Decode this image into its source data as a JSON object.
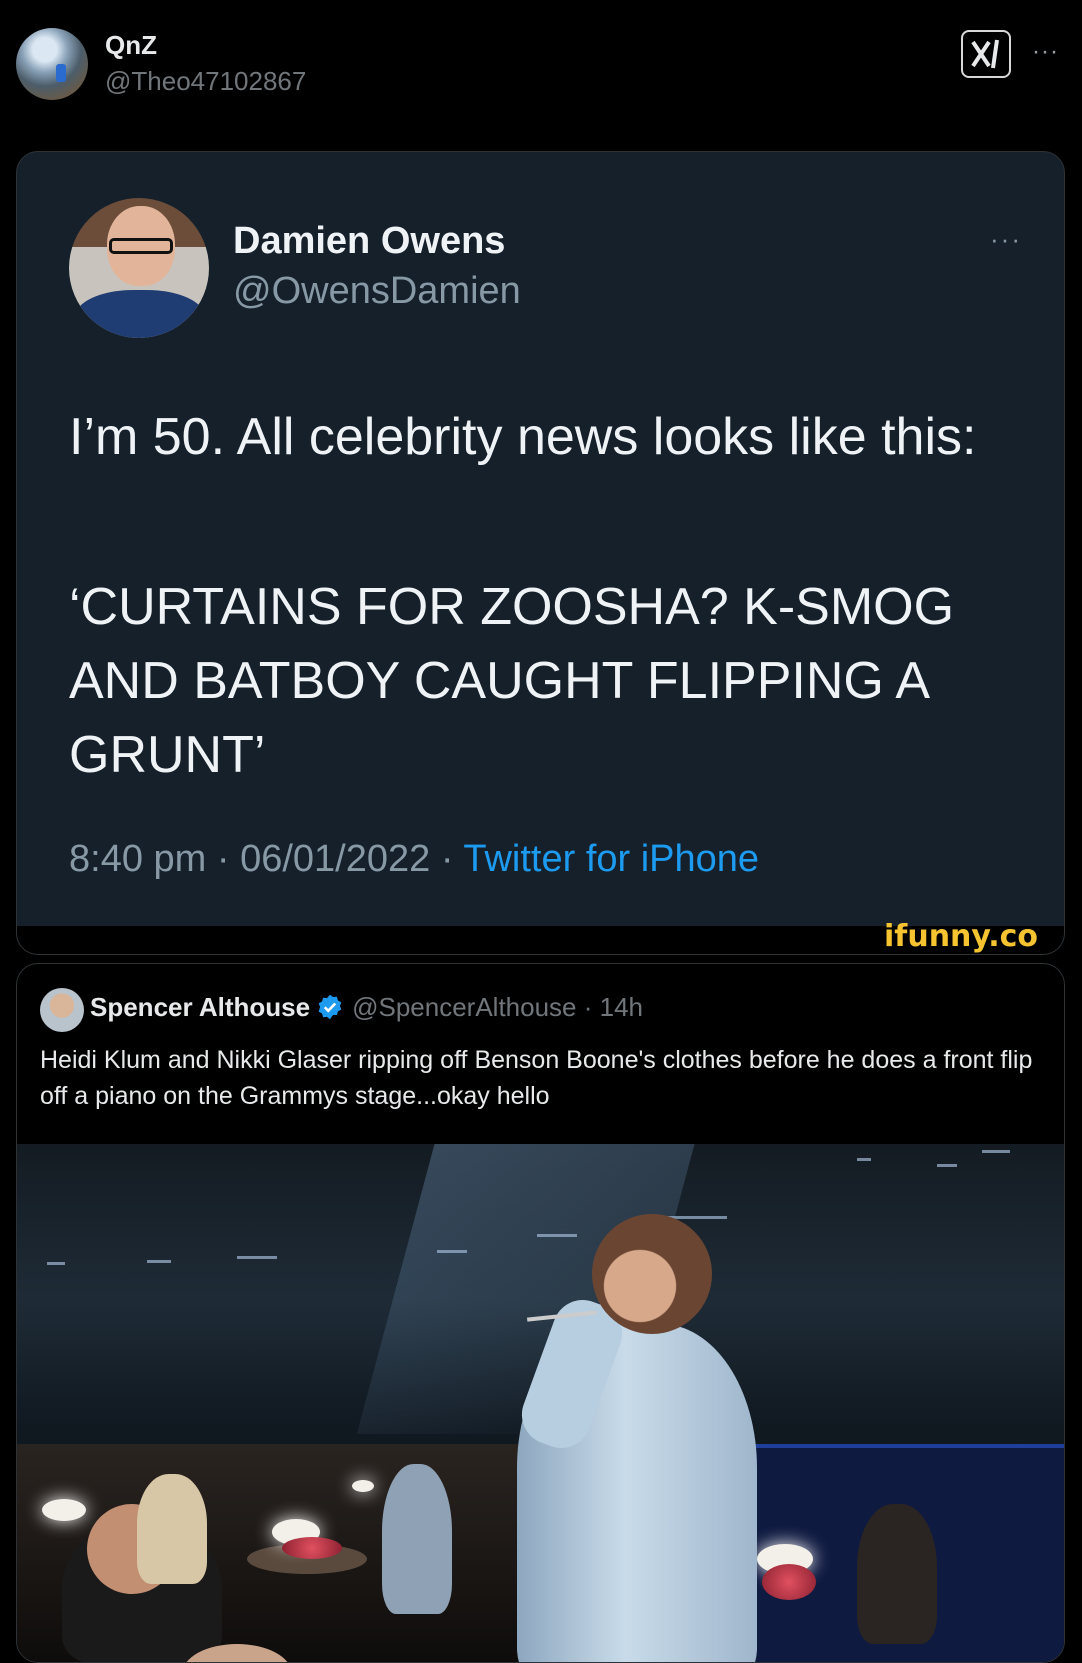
{
  "header": {
    "display_name": "QnZ",
    "handle": "@Theo47102867",
    "more_label": "···"
  },
  "screenshot_tweet": {
    "name": "Damien Owens",
    "handle": "@OwensDamien",
    "more_label": "···",
    "text_line": "I’m 50. All celebrity news looks like this:",
    "quote": "‘CURTAINS FOR ZOOSHA? K-SMOG AND BATBOY CAUGHT FLIPPING A GRUNT’",
    "time": "8:40 pm",
    "date": "06/01/2022",
    "source": "Twitter for iPhone",
    "watermark": "ifunny.co"
  },
  "quoted_tweet": {
    "name": "Spencer Althouse",
    "handle": "@SpencerAlthouse",
    "age": "14h",
    "text": "Heidi Klum and Nikki Glaser ripping off Benson Boone's clothes before he does a front flip off a piano on the Grammys stage...okay hello"
  },
  "colors": {
    "background": "#000000",
    "card_dark": "#15202b",
    "link_blue": "#1d9bf0",
    "muted": "#71767b",
    "verified": "#1d9bf0",
    "watermark": "#f6c430"
  },
  "icons": {
    "grok": "grok-icon",
    "more": "more-icon",
    "verified": "verified-badge-icon"
  }
}
